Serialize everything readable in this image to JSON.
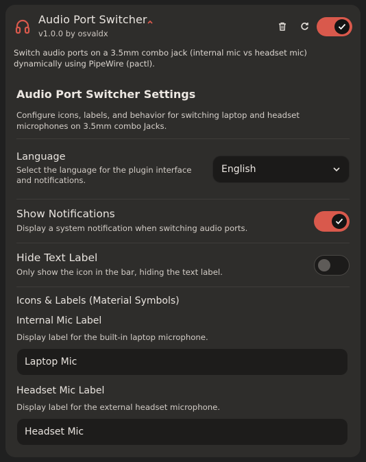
{
  "plugin": {
    "title": "Audio Port Switcher",
    "version": "v1.0.0 by osvaldx",
    "description": "Switch audio ports on a 3.5mm combo jack (internal mic vs headset mic) dynamically using PipeWire (pactl).",
    "enabled": true,
    "accent_color": "#d9594c",
    "icons": {
      "plugin": "headset-icon",
      "collapse": "chevron-up-icon",
      "delete": "trash-icon",
      "reload": "refresh-icon",
      "enabled": "check-icon"
    }
  },
  "settings": {
    "heading": "Audio Port Switcher Settings",
    "description": "Configure icons, labels, and behavior for switching laptop and headset microphones on 3.5mm combo Jacks.",
    "language": {
      "title": "Language",
      "description": "Select the language for the plugin interface and notifications.",
      "value": "English"
    },
    "show_notifications": {
      "title": "Show Notifications",
      "description": "Display a system notification when switching audio ports.",
      "enabled": true
    },
    "hide_text_label": {
      "title": "Hide Text Label",
      "description": "Only show the icon in the bar, hiding the text label.",
      "enabled": false
    },
    "icons_labels_heading": "Icons & Labels (Material Symbols)",
    "internal_mic": {
      "title": "Internal Mic Label",
      "description": "Display label for the built-in laptop microphone.",
      "value": "Laptop Mic"
    },
    "headset_mic": {
      "title": "Headset Mic Label",
      "description": "Display label for the external headset microphone.",
      "value": "Headset Mic"
    }
  }
}
